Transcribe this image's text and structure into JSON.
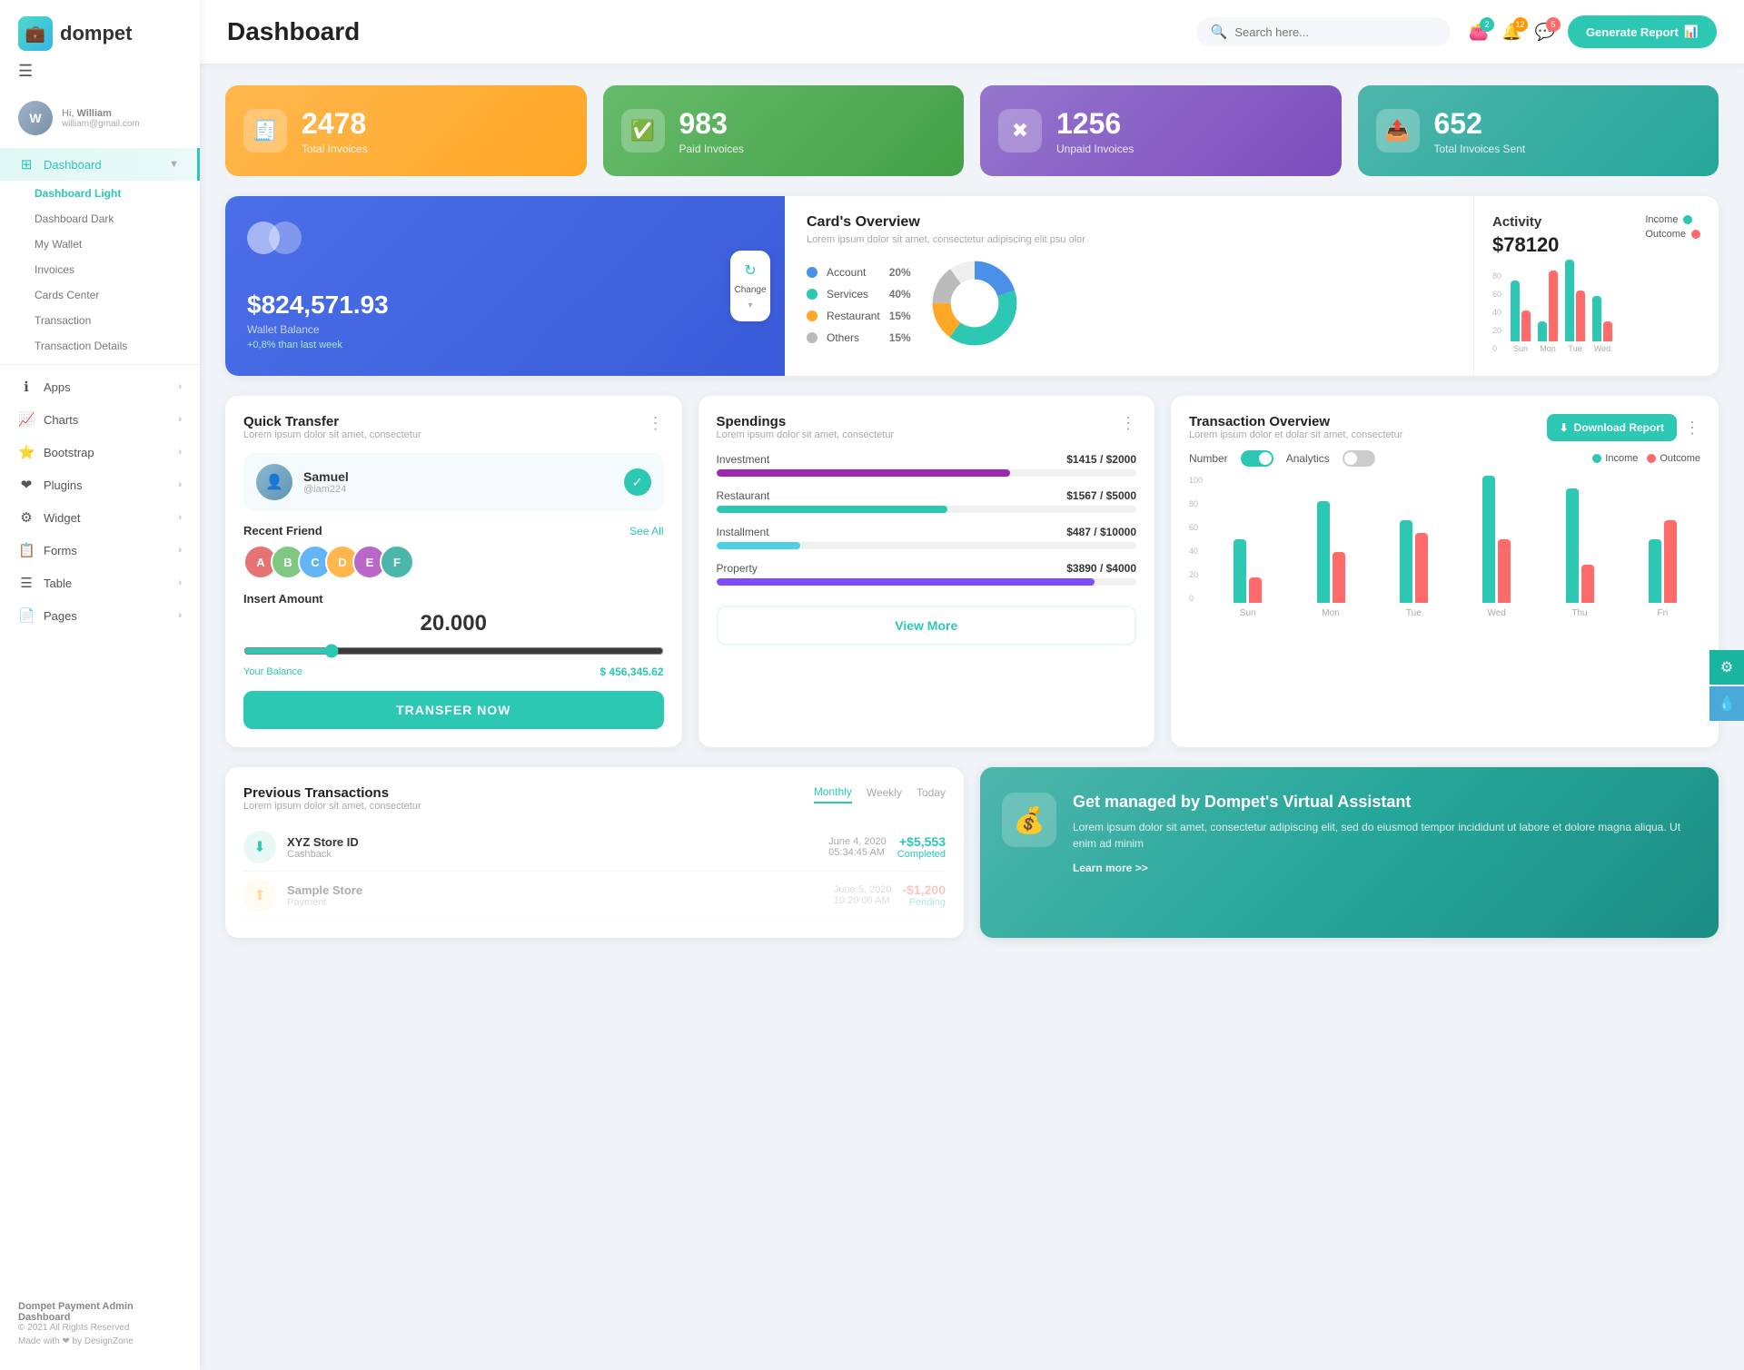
{
  "app": {
    "logo_text": "dompet",
    "title": "Dashboard"
  },
  "sidebar": {
    "user": {
      "greeting": "Hi, William",
      "name": "William",
      "email": "william@gmail.com"
    },
    "nav": {
      "dashboard_label": "Dashboard",
      "sub_items": [
        {
          "label": "Dashboard Light",
          "active": true
        },
        {
          "label": "Dashboard Dark",
          "active": false
        },
        {
          "label": "My Wallet",
          "active": false
        },
        {
          "label": "Invoices",
          "active": false
        },
        {
          "label": "Cards Center",
          "active": false
        },
        {
          "label": "Transaction",
          "active": false
        },
        {
          "label": "Transaction Details",
          "active": false
        }
      ],
      "items": [
        {
          "icon": "ℹ",
          "label": "Apps",
          "has_arrow": true
        },
        {
          "icon": "📈",
          "label": "Charts",
          "has_arrow": true
        },
        {
          "icon": "⭐",
          "label": "Bootstrap",
          "has_arrow": true
        },
        {
          "icon": "❤",
          "label": "Plugins",
          "has_arrow": true
        },
        {
          "icon": "⚙",
          "label": "Widget",
          "has_arrow": true
        },
        {
          "icon": "📋",
          "label": "Forms",
          "has_arrow": true
        },
        {
          "icon": "☰",
          "label": "Table",
          "has_arrow": true
        },
        {
          "icon": "📄",
          "label": "Pages",
          "has_arrow": true
        }
      ]
    },
    "footer": {
      "brand": "Dompet Payment Admin Dashboard",
      "year": "© 2021 All Rights Reserved",
      "made_with": "Made with ❤ by DesignZone"
    }
  },
  "topbar": {
    "search_placeholder": "Search here...",
    "badge_wallet": "2",
    "badge_bell": "12",
    "badge_chat": "5",
    "generate_btn": "Generate Report"
  },
  "stats": [
    {
      "number": "2478",
      "label": "Total Invoices",
      "icon": "🧾",
      "color": "orange"
    },
    {
      "number": "983",
      "label": "Paid Invoices",
      "icon": "✅",
      "color": "green"
    },
    {
      "number": "1256",
      "label": "Unpaid Invoices",
      "icon": "❌",
      "color": "purple"
    },
    {
      "number": "652",
      "label": "Total Invoices Sent",
      "icon": "📤",
      "color": "teal"
    }
  ],
  "cards_overview": {
    "balance": "$824,571.93",
    "wallet_label": "Wallet Balance",
    "change_text": "+0,8% than last week",
    "change_btn_label": "Change",
    "breakdown_title": "Card's Overview",
    "breakdown_sub": "Lorem ipsum dolor sit amet, consectetur adipiscing elit psu olor",
    "items": [
      {
        "name": "Account",
        "pct": "20%",
        "color": "#4a8fe8"
      },
      {
        "name": "Services",
        "pct": "40%",
        "color": "#2cc8b4"
      },
      {
        "name": "Restaurant",
        "pct": "15%",
        "color": "#ffa726"
      },
      {
        "name": "Others",
        "pct": "15%",
        "color": "#bbb"
      }
    ]
  },
  "activity": {
    "title": "Activity",
    "amount": "$78120",
    "income_label": "Income",
    "outcome_label": "Outcome",
    "income_color": "#2cc8b4",
    "outcome_color": "#ff6b6b",
    "bars": [
      {
        "day": "Sun",
        "income": 60,
        "outcome": 30
      },
      {
        "day": "Mon",
        "income": 20,
        "outcome": 70
      },
      {
        "day": "Tue",
        "income": 80,
        "outcome": 50
      },
      {
        "day": "Wed",
        "income": 45,
        "outcome": 20
      }
    ]
  },
  "quick_transfer": {
    "title": "Quick Transfer",
    "sub": "Lorem ipsum dolor sit amet, consectetur",
    "user_name": "Samuel",
    "user_handle": "@iam224",
    "recent_friend_label": "Recent Friend",
    "see_all": "See All",
    "insert_amount_label": "Insert Amount",
    "amount": "20.000",
    "balance_label": "Your Balance",
    "balance_amount": "$ 456,345.62",
    "transfer_btn": "TRANSFER NOW",
    "friend_colors": [
      "#e57373",
      "#81c784",
      "#64b5f6",
      "#ffb74d",
      "#ba68c8",
      "#4db6ac"
    ]
  },
  "spendings": {
    "title": "Spendings",
    "sub": "Lorem ipsum dolor sit amet, consectetur",
    "items": [
      {
        "label": "Investment",
        "amount": "$1415",
        "max": "$2000",
        "color": "#9c27b0",
        "pct": 70
      },
      {
        "label": "Restaurant",
        "amount": "$1567",
        "max": "$5000",
        "color": "#2cc8b4",
        "pct": 55
      },
      {
        "label": "Installment",
        "amount": "$487",
        "max": "$10000",
        "color": "#4dd0e1",
        "pct": 20
      },
      {
        "label": "Property",
        "amount": "$3890",
        "max": "$4000",
        "color": "#7c4dff",
        "pct": 90
      }
    ],
    "view_more": "View More"
  },
  "transaction_overview": {
    "title": "Transaction Overview",
    "sub": "Lorem ipsum dolor et dolar sit amet, consectetur",
    "download_btn": "Download Report",
    "number_label": "Number",
    "analytics_label": "Analytics",
    "income_label": "Income",
    "outcome_label": "Outcome",
    "income_color": "#2cc8b4",
    "outcome_color": "#ff6b6b",
    "bars": [
      {
        "day": "Sun",
        "income": 50,
        "outcome": 20
      },
      {
        "day": "Mon",
        "income": 80,
        "outcome": 40
      },
      {
        "day": "Tue",
        "income": 65,
        "outcome": 55
      },
      {
        "day": "Wed",
        "income": 100,
        "outcome": 50
      },
      {
        "day": "Thu",
        "income": 90,
        "outcome": 30
      },
      {
        "day": "Fri",
        "income": 50,
        "outcome": 65
      }
    ],
    "y_labels": [
      "100",
      "80",
      "60",
      "40",
      "20",
      "0"
    ]
  },
  "prev_transactions": {
    "title": "Previous Transactions",
    "sub": "Lorem ipsum dolor sit amet, consectetur",
    "tabs": [
      "Monthly",
      "Weekly",
      "Today"
    ],
    "active_tab": 0,
    "items": [
      {
        "icon": "⬇",
        "name": "XYZ Store ID",
        "type": "Cashback",
        "date": "June 4, 2020",
        "time": "05:34:45 AM",
        "amount": "+$5,553",
        "status": "Completed",
        "positive": true
      }
    ]
  },
  "virtual_assistant": {
    "title": "Get managed by Dompet's Virtual Assistant",
    "text": "Lorem ipsum dolor sit amet, consectetur adipiscing elit, sed do eiusmod tempor incididunt ut labore et dolore magna aliqua. Ut enim ad minim",
    "link": "Learn more >>"
  }
}
